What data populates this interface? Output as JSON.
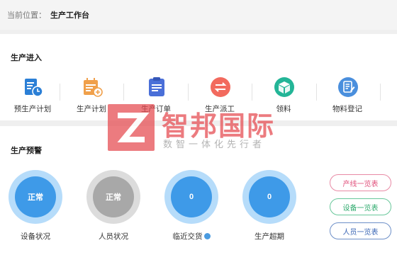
{
  "breadcrumb": {
    "prefix": "当前位置：",
    "current": "生产工作台"
  },
  "entry_section": {
    "title": "生产进入",
    "items": [
      {
        "label": "预生产计划",
        "icon": "schedule-doc-icon",
        "color": "#2b7fd6"
      },
      {
        "label": "生产计划",
        "icon": "calendar-add-icon",
        "color": "#f0a04b"
      },
      {
        "label": "生产订单",
        "icon": "clipboard-icon",
        "color": "#4a6fd8"
      },
      {
        "label": "生产派工",
        "icon": "exchange-icon",
        "color": "#f26a5e"
      },
      {
        "label": "领料",
        "icon": "box-icon",
        "color": "#23b597"
      },
      {
        "label": "物料登记",
        "icon": "edit-doc-icon",
        "color": "#4a8fdd"
      }
    ]
  },
  "warning_section": {
    "title": "生产预警",
    "gauges": [
      {
        "value": "正常",
        "label": "设备状况",
        "color": "#3e9ae8"
      },
      {
        "value": "正常",
        "label": "人员状况",
        "color": "#a8a8a8"
      },
      {
        "value": "0",
        "label": "临近交货",
        "color": "#3e9ae8"
      },
      {
        "value": "0",
        "label": "生产超期",
        "color": "#3e9ae8"
      }
    ],
    "buttons": [
      {
        "label": "产线一览表",
        "color": "#e04e7a"
      },
      {
        "label": "设备一览表",
        "color": "#2eaa6d"
      },
      {
        "label": "人员一览表",
        "color": "#3a66b5"
      }
    ]
  },
  "watermark": {
    "title": "智邦国际",
    "subtitle": "数智一体化先行者"
  }
}
